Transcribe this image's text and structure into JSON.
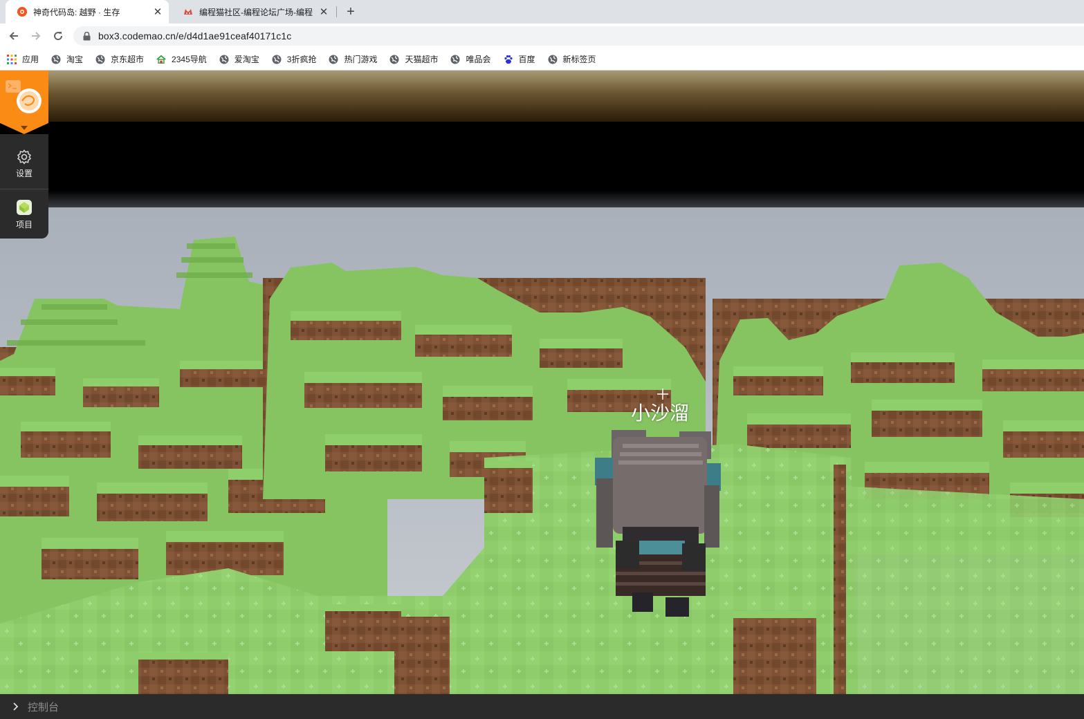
{
  "browser": {
    "tabs": [
      {
        "title": "神奇代码岛: 越野 · 生存",
        "active": true,
        "icon": "codemao-flower-icon"
      },
      {
        "title": "编程猫社区-编程论坛广场-编程学",
        "active": false,
        "icon": "codemao-cat-icon"
      }
    ],
    "url": "box3.codemao.cn/e/d4d1ae91ceaf40171c1c",
    "bookmarks": [
      {
        "label": "应用",
        "icon": "apps-grid-icon"
      },
      {
        "label": "淘宝",
        "icon": "globe-icon"
      },
      {
        "label": "京东超市",
        "icon": "globe-icon"
      },
      {
        "label": "2345导航",
        "icon": "house-icon"
      },
      {
        "label": "爱淘宝",
        "icon": "globe-icon"
      },
      {
        "label": "3折疯抢",
        "icon": "globe-icon"
      },
      {
        "label": "热门游戏",
        "icon": "globe-icon"
      },
      {
        "label": "天猫超市",
        "icon": "globe-icon"
      },
      {
        "label": "唯品会",
        "icon": "globe-icon"
      },
      {
        "label": "百度",
        "icon": "paw-icon"
      },
      {
        "label": "新标签页",
        "icon": "globe-icon"
      }
    ]
  },
  "sidebar": {
    "items": [
      {
        "label": "设置",
        "icon": "gear-icon"
      },
      {
        "label": "项目",
        "icon": "project-icon"
      }
    ]
  },
  "game": {
    "player_name": "小沙溜"
  },
  "console": {
    "label": "控制台"
  },
  "colors": {
    "brand_orange": "#fa8c16",
    "grass_top": "#8fcf6e",
    "sky": "#b8bec6",
    "panel_dark": "#2b2b2b"
  }
}
